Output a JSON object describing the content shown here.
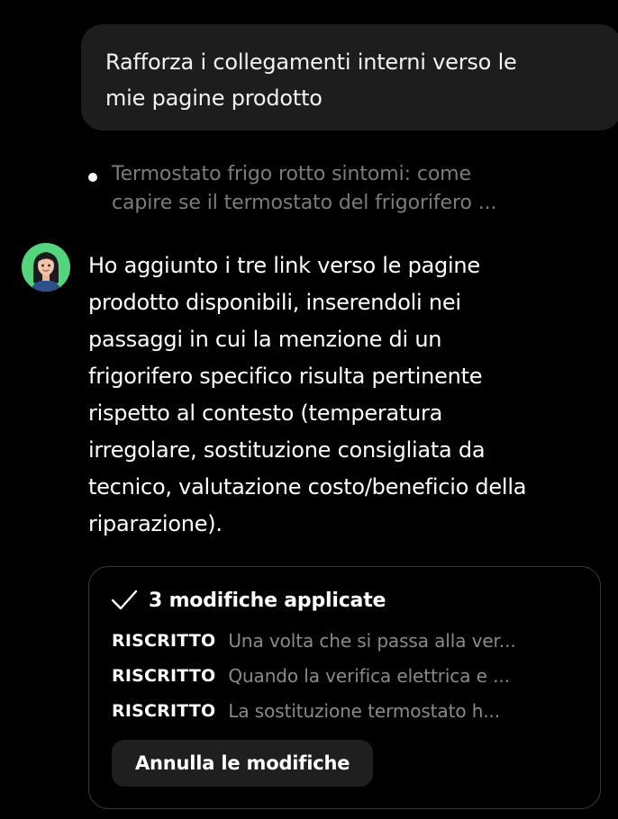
{
  "user_message": {
    "line1": "Rafforza i collegamenti interni verso le",
    "line2": "mie pagine prodotto"
  },
  "source": {
    "line1": "Termostato frigo rotto sintomi: come",
    "line2": "capire se il termostato del frigorifero ..."
  },
  "assistant": {
    "avatar_icon": "woman-avatar-icon",
    "avatar_color": "#53d47d",
    "lines": [
      "Ho aggiunto i tre link verso le pagine",
      "prodotto disponibili, inserendoli nei",
      "passaggi in cui la menzione di un",
      "frigorifero specifico risulta pertinente",
      "rispetto al contesto (temperatura",
      "irregolare, sostituzione consigliata da",
      "tecnico, valutazione costo/beneficio della",
      "riparazione)."
    ]
  },
  "changes": {
    "title": "3 modifiche applicate",
    "icon": "check-icon",
    "items": [
      {
        "label": "RISCRITTO",
        "text": "Una volta che si passa alla ver..."
      },
      {
        "label": "RISCRITTO",
        "text": "Quando la verifica elettrica e ..."
      },
      {
        "label": "RISCRITTO",
        "text": "La sostituzione termostato h..."
      }
    ],
    "undo_label": "Annulla le modifiche"
  }
}
